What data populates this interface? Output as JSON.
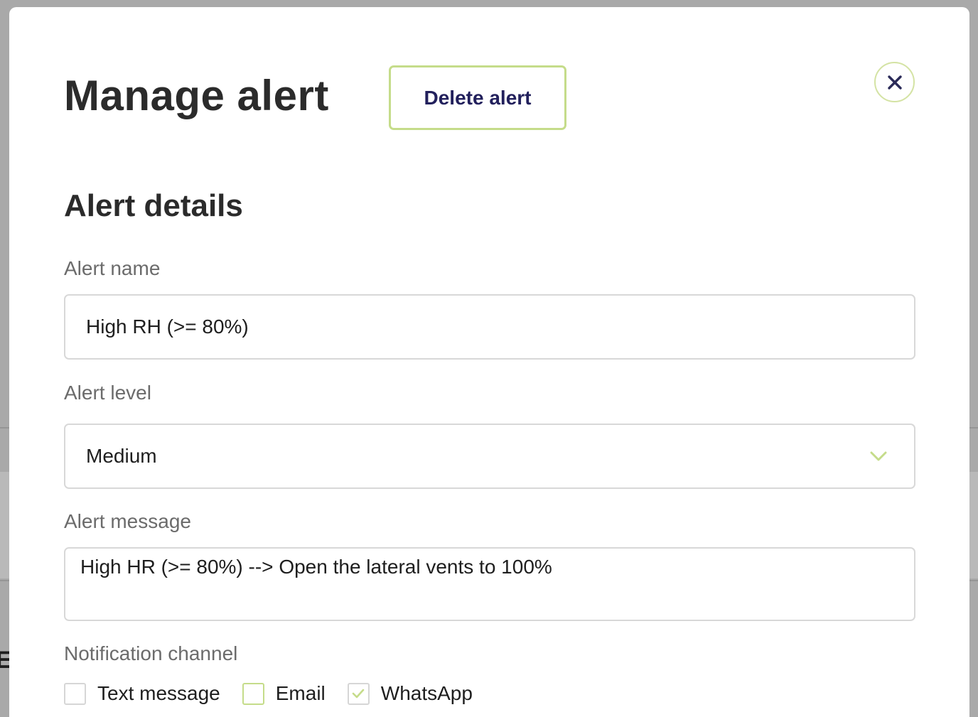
{
  "modal": {
    "title": "Manage alert",
    "delete_label": "Delete alert",
    "section_title": "Alert details"
  },
  "fields": {
    "name_label": "Alert name",
    "name_value": "High RH (>= 80%)",
    "level_label": "Alert level",
    "level_value": "Medium",
    "message_label": "Alert message",
    "message_value": "High HR (>= 80%) --> Open the lateral vents to 100%"
  },
  "notification": {
    "label": "Notification channel",
    "options": [
      {
        "label": "Text message",
        "checked": false
      },
      {
        "label": "Email",
        "checked": false
      },
      {
        "label": "WhatsApp",
        "checked": true
      }
    ]
  },
  "background": {
    "partial_letter": "E"
  },
  "colors": {
    "accent_border": "#c5dc8a",
    "button_text": "#22205c",
    "close_icon": "#2a2a58"
  },
  "icons": {
    "close": "close-icon",
    "dropdown": "chevron-down-icon",
    "checkmark": "checkmark-icon"
  }
}
